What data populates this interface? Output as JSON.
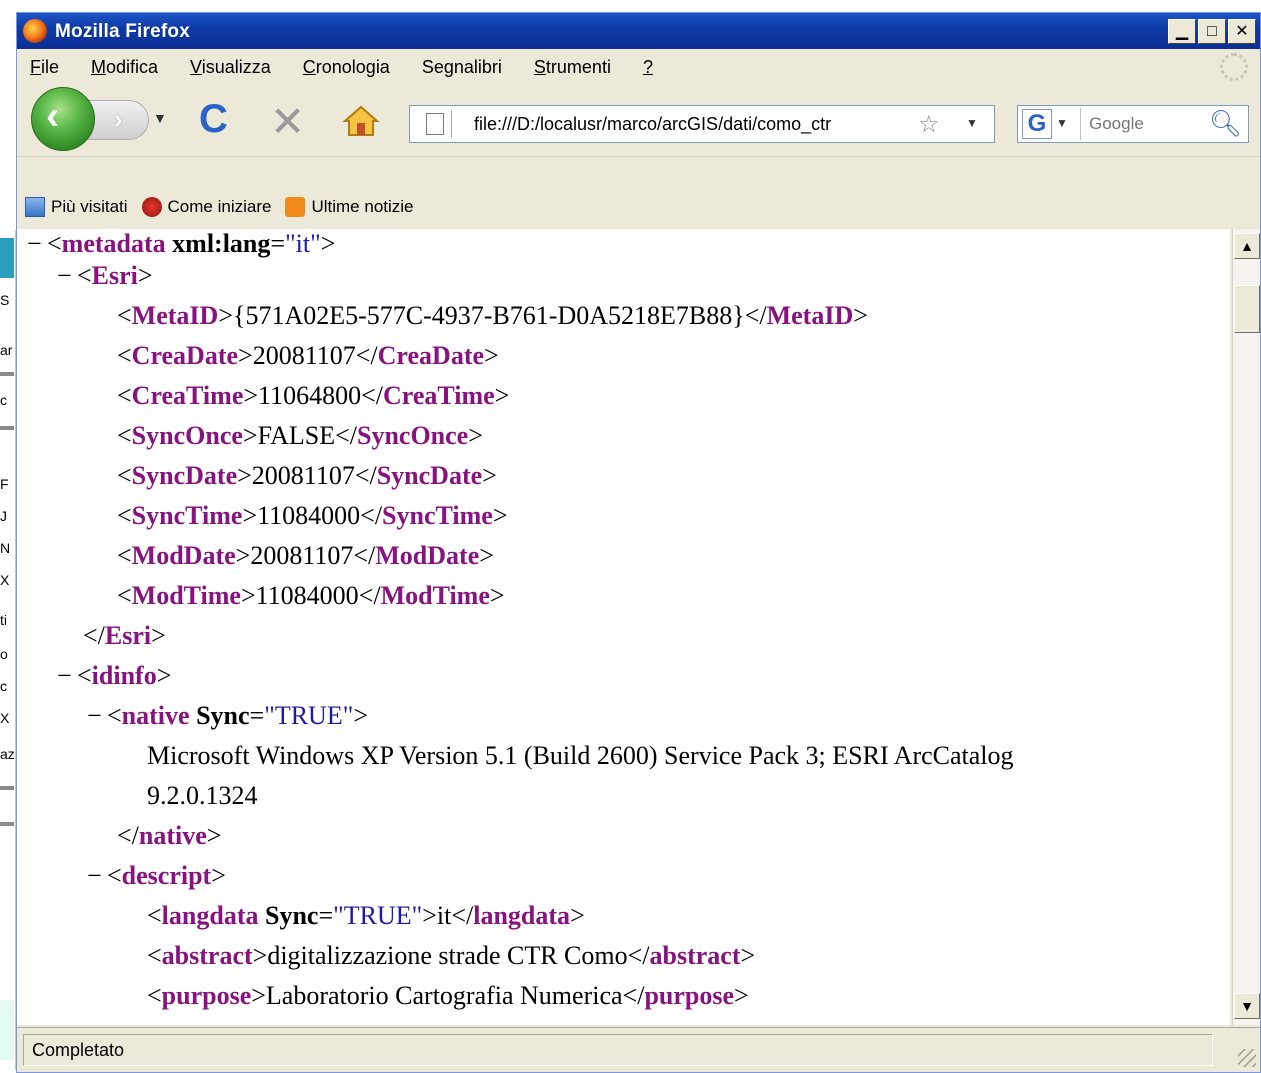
{
  "window": {
    "title": "Mozilla Firefox"
  },
  "menu": [
    {
      "label": "File",
      "underline": "F"
    },
    {
      "label": "Modifica",
      "underline": "M"
    },
    {
      "label": "Visualizza",
      "underline": "V"
    },
    {
      "label": "Cronologia",
      "underline": "C"
    },
    {
      "label": "Segnalibri",
      "underline": "g"
    },
    {
      "label": "Strumenti",
      "underline": "S"
    },
    {
      "label": "?",
      "underline": "?"
    }
  ],
  "navbar": {
    "url": "file:///D:/localusr/marco/arcGIS/dati/como_ctr",
    "search_placeholder": "Google",
    "search_engine": "G"
  },
  "bookmarks": [
    {
      "label": "Più visitati",
      "icon": "most-visited-icon"
    },
    {
      "label": "Come iniziare",
      "icon": "firefox-start-icon"
    },
    {
      "label": "Ultime notizie",
      "icon": "rss-icon"
    }
  ],
  "xml": {
    "l1": {
      "toggle": "−",
      "open": "<",
      "tag": "metadata",
      "attr": " xml:lang",
      "eq": "=",
      "val": "\"it\"",
      "close": ">"
    },
    "l2": {
      "toggle": "−",
      "tag": "Esri"
    },
    "l3": {
      "tag": "MetaID",
      "value": "{571A02E5-577C-4937-B761-D0A5218E7B88}"
    },
    "l4": {
      "tag": "CreaDate",
      "value": "20081107"
    },
    "l5": {
      "tag": "CreaTime",
      "value": "11064800"
    },
    "l6": {
      "tag": "SyncOnce",
      "value": "FALSE"
    },
    "l7": {
      "tag": "SyncDate",
      "value": "20081107"
    },
    "l8": {
      "tag": "SyncTime",
      "value": "11084000"
    },
    "l9": {
      "tag": "ModDate",
      "value": "20081107"
    },
    "l10": {
      "tag": "ModTime",
      "value": "11084000"
    },
    "l11": {
      "tag": "Esri"
    },
    "l12": {
      "toggle": "−",
      "tag": "idinfo"
    },
    "l13": {
      "toggle": "−",
      "tag": "native",
      "attr": "Sync",
      "val": "\"TRUE\""
    },
    "l14": {
      "text": "Microsoft Windows XP Version 5.1 (Build 2600) Service Pack 3; ESRI ArcCatalog"
    },
    "l15": {
      "text": "9.2.0.1324"
    },
    "l16": {
      "tag": "native"
    },
    "l17": {
      "toggle": "−",
      "tag": "descript"
    },
    "l18": {
      "tag": "langdata",
      "attr": "Sync",
      "val": "\"TRUE\"",
      "value": "it"
    },
    "l19": {
      "tag": "abstract",
      "value": "digitalizzazione strade CTR Como"
    },
    "l20": {
      "tag": "purpose",
      "value": "Laboratorio Cartografia Numerica"
    }
  },
  "status": {
    "text": "Completato"
  },
  "bg_strip": [
    "S",
    "ar",
    "c",
    "F",
    "J",
    "N",
    "X",
    "ti",
    "o",
    "c",
    "X",
    "az"
  ],
  "colors": {
    "tag": "#881280",
    "attr_value": "#1a1aa6",
    "titlebar": "#0f3aa6"
  }
}
